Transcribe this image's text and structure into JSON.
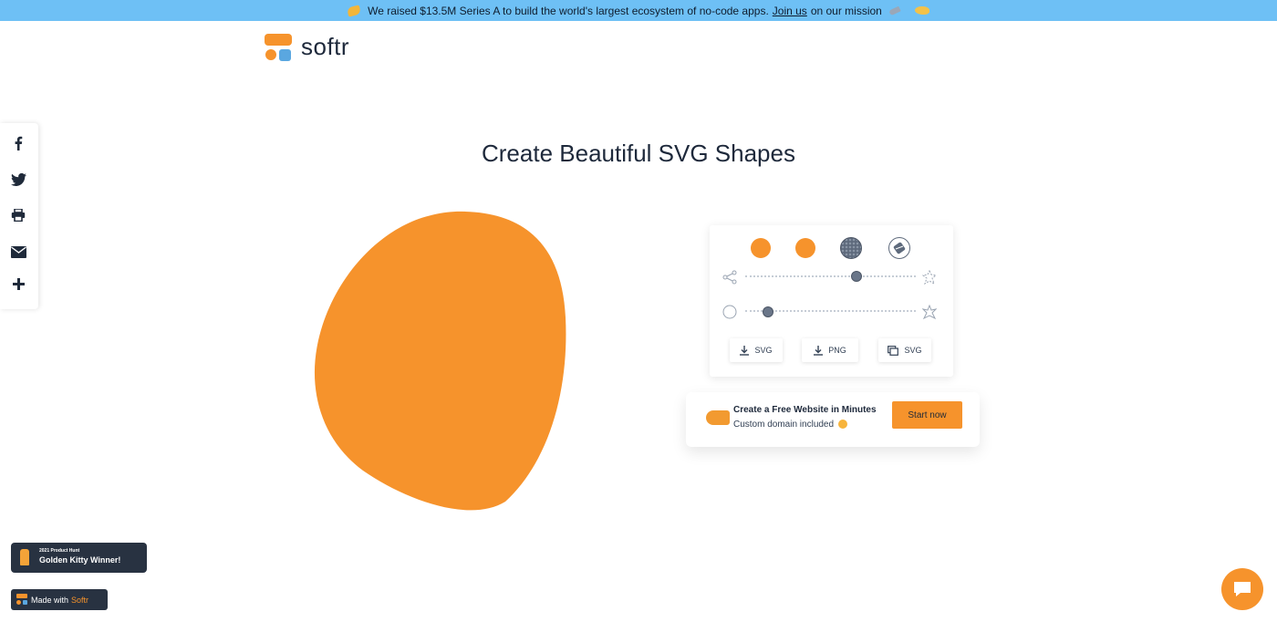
{
  "banner": {
    "text_before": "We raised $13.5M Series A to build the world's largest ecosystem of no-code apps.",
    "link": "Join us",
    "text_after": "on our mission"
  },
  "logo": {
    "word": "softr"
  },
  "share": [
    "facebook-icon",
    "twitter-icon",
    "print-icon",
    "email-icon",
    "plus-icon"
  ],
  "heading": "Create Beautiful SVG Shapes",
  "shape": {
    "fill": "#f6932c"
  },
  "editor": {
    "swatches": [
      {
        "name": "solid-orange",
        "color": "#f6932c"
      },
      {
        "name": "gradient-orange",
        "color": "#f6932c"
      },
      {
        "name": "pattern-gray",
        "color": "#6a7689"
      },
      {
        "name": "image-fill",
        "color": "#ffffff"
      }
    ],
    "complexity": 0.65,
    "contrast": 0.13,
    "buttons": [
      {
        "label": "SVG",
        "icon": "download-icon"
      },
      {
        "label": "PNG",
        "icon": "download-icon"
      },
      {
        "label": "SVG",
        "icon": "copy-icon"
      }
    ]
  },
  "cta": {
    "title": "Create a Free Website in Minutes",
    "subtitle": "Custom domain included",
    "button": "Start now"
  },
  "badges": {
    "kitty_small": "2021 Product Hunt",
    "kitty_big": "Golden Kitty Winner!",
    "made_with": "Made with",
    "made_brand": "Softr"
  },
  "colors": {
    "accent": "#f6932c",
    "banner": "#6ec0f5",
    "dark": "#283241"
  }
}
